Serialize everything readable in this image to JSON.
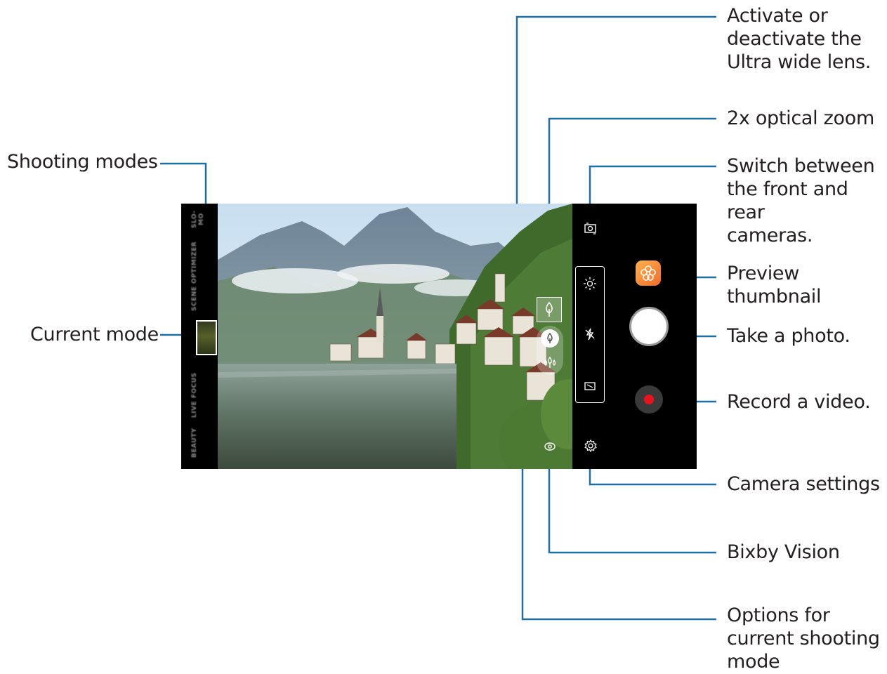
{
  "callouts": {
    "ultra_wide": [
      "Activate or",
      "deactivate the",
      "Ultra wide lens."
    ],
    "optical_zoom": "2x optical zoom",
    "switch_camera": [
      "Switch between",
      "the front and rear",
      "cameras."
    ],
    "preview_thumbnail": [
      "Preview",
      "thumbnail"
    ],
    "take_photo": "Take a photo.",
    "record_video": "Record a video.",
    "camera_settings": "Camera settings",
    "bixby_vision": "Bixby Vision",
    "shooting_options": [
      "Options for",
      "current shooting",
      "mode"
    ],
    "shooting_modes": "Shooting modes",
    "current_mode": "Current mode"
  },
  "camera": {
    "modes": [
      "BEAUTY",
      "LIVE FOCUS",
      "SCENE OPTIMIZER",
      "SLO-MO"
    ]
  },
  "colors": {
    "callout_line": "#1d6fa5",
    "record": "#e8131c",
    "thumbnail": "#f48a32"
  },
  "icons": {
    "switch_camera": "switch-camera-icon",
    "thumbnail": "flower-icon",
    "scene_optimizer": "sun-icon",
    "flash": "flash-off-icon",
    "ratio": "ratio-icon",
    "settings": "gear-icon",
    "bixby": "bixby-icon"
  }
}
